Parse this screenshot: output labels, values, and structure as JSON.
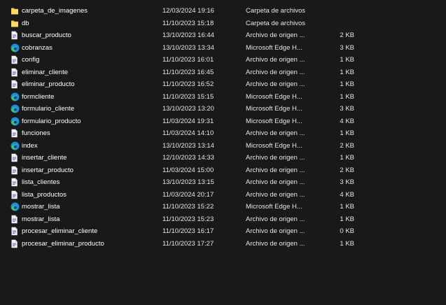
{
  "files": [
    {
      "name": "carpeta_de_imagenes",
      "date": "12/03/2024 19:16",
      "type": "Carpeta de archivos",
      "size": "",
      "icon": "folder-icon"
    },
    {
      "name": "db",
      "date": "11/10/2023 15:18",
      "type": "Carpeta de archivos",
      "size": "",
      "icon": "folder-icon"
    },
    {
      "name": "buscar_producto",
      "date": "13/10/2023 16:44",
      "type": "Archivo de origen ...",
      "size": "2 KB",
      "icon": "php-file-icon"
    },
    {
      "name": "cobranzas",
      "date": "13/10/2023 13:34",
      "type": "Microsoft Edge H...",
      "size": "3 KB",
      "icon": "edge-html-icon"
    },
    {
      "name": "config",
      "date": "11/10/2023 16:01",
      "type": "Archivo de origen ...",
      "size": "1 KB",
      "icon": "php-file-icon"
    },
    {
      "name": "eliminar_cliente",
      "date": "11/10/2023 16:45",
      "type": "Archivo de origen ...",
      "size": "1 KB",
      "icon": "php-file-icon"
    },
    {
      "name": "eliminar_producto",
      "date": "11/10/2023 16:52",
      "type": "Archivo de origen ...",
      "size": "1 KB",
      "icon": "php-file-icon"
    },
    {
      "name": "formcliente",
      "date": "11/10/2023 15:15",
      "type": "Microsoft Edge H...",
      "size": "1 KB",
      "icon": "edge-html-icon"
    },
    {
      "name": "formulario_cliente",
      "date": "13/10/2023 13:20",
      "type": "Microsoft Edge H...",
      "size": "3 KB",
      "icon": "edge-html-icon"
    },
    {
      "name": "formulario_producto",
      "date": "11/03/2024 19:31",
      "type": "Microsoft Edge H...",
      "size": "4 KB",
      "icon": "edge-html-icon"
    },
    {
      "name": "funciones",
      "date": "11/03/2024 14:10",
      "type": "Archivo de origen ...",
      "size": "1 KB",
      "icon": "php-file-icon"
    },
    {
      "name": "index",
      "date": "13/10/2023 13:14",
      "type": "Microsoft Edge H...",
      "size": "2 KB",
      "icon": "edge-html-icon"
    },
    {
      "name": "insertar_cliente",
      "date": "12/10/2023 14:33",
      "type": "Archivo de origen ...",
      "size": "1 KB",
      "icon": "php-file-icon"
    },
    {
      "name": "insertar_producto",
      "date": "11/03/2024 15:00",
      "type": "Archivo de origen ...",
      "size": "2 KB",
      "icon": "php-file-icon"
    },
    {
      "name": "lista_clientes",
      "date": "13/10/2023 13:15",
      "type": "Archivo de origen ...",
      "size": "3 KB",
      "icon": "php-file-icon"
    },
    {
      "name": "lista_productos",
      "date": "11/03/2024 20:17",
      "type": "Archivo de origen ...",
      "size": "4 KB",
      "icon": "php-file-icon"
    },
    {
      "name": "mostrar_lista",
      "date": "11/10/2023 15:22",
      "type": "Microsoft Edge H...",
      "size": "1 KB",
      "icon": "edge-html-icon"
    },
    {
      "name": "mostrar_lista",
      "date": "11/10/2023 15:23",
      "type": "Archivo de origen ...",
      "size": "1 KB",
      "icon": "php-file-icon"
    },
    {
      "name": "procesar_eliminar_cliente",
      "date": "11/10/2023 16:17",
      "type": "Archivo de origen ...",
      "size": "0 KB",
      "icon": "php-file-icon"
    },
    {
      "name": "procesar_eliminar_producto",
      "date": "11/10/2023 17:27",
      "type": "Archivo de origen ...",
      "size": "1 KB",
      "icon": "php-file-icon"
    }
  ],
  "colors": {
    "background": "#191919",
    "text": "#ffffff",
    "folder": "#f2c94c",
    "edge_blue": "#1d8ce0",
    "edge_green": "#3ec46d"
  }
}
